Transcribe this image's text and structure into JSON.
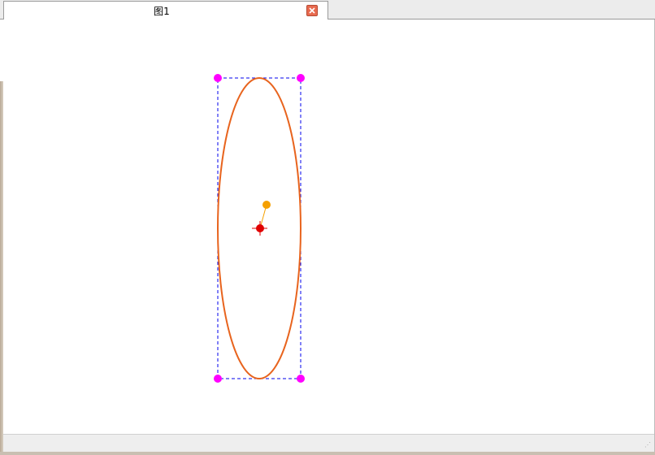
{
  "tab": {
    "title": "图1",
    "close_icon": "close-icon"
  },
  "drawing": {
    "shape": "ellipse",
    "stroke_color": "#e8641e",
    "bounding_box_color": "#0000ee",
    "handle_color": "#ff00ff",
    "center_marker_color": "#e00000",
    "rotation_handle_color": "#f5a000"
  },
  "statusbar": {
    "grip_icon": "resize-grip-icon"
  }
}
